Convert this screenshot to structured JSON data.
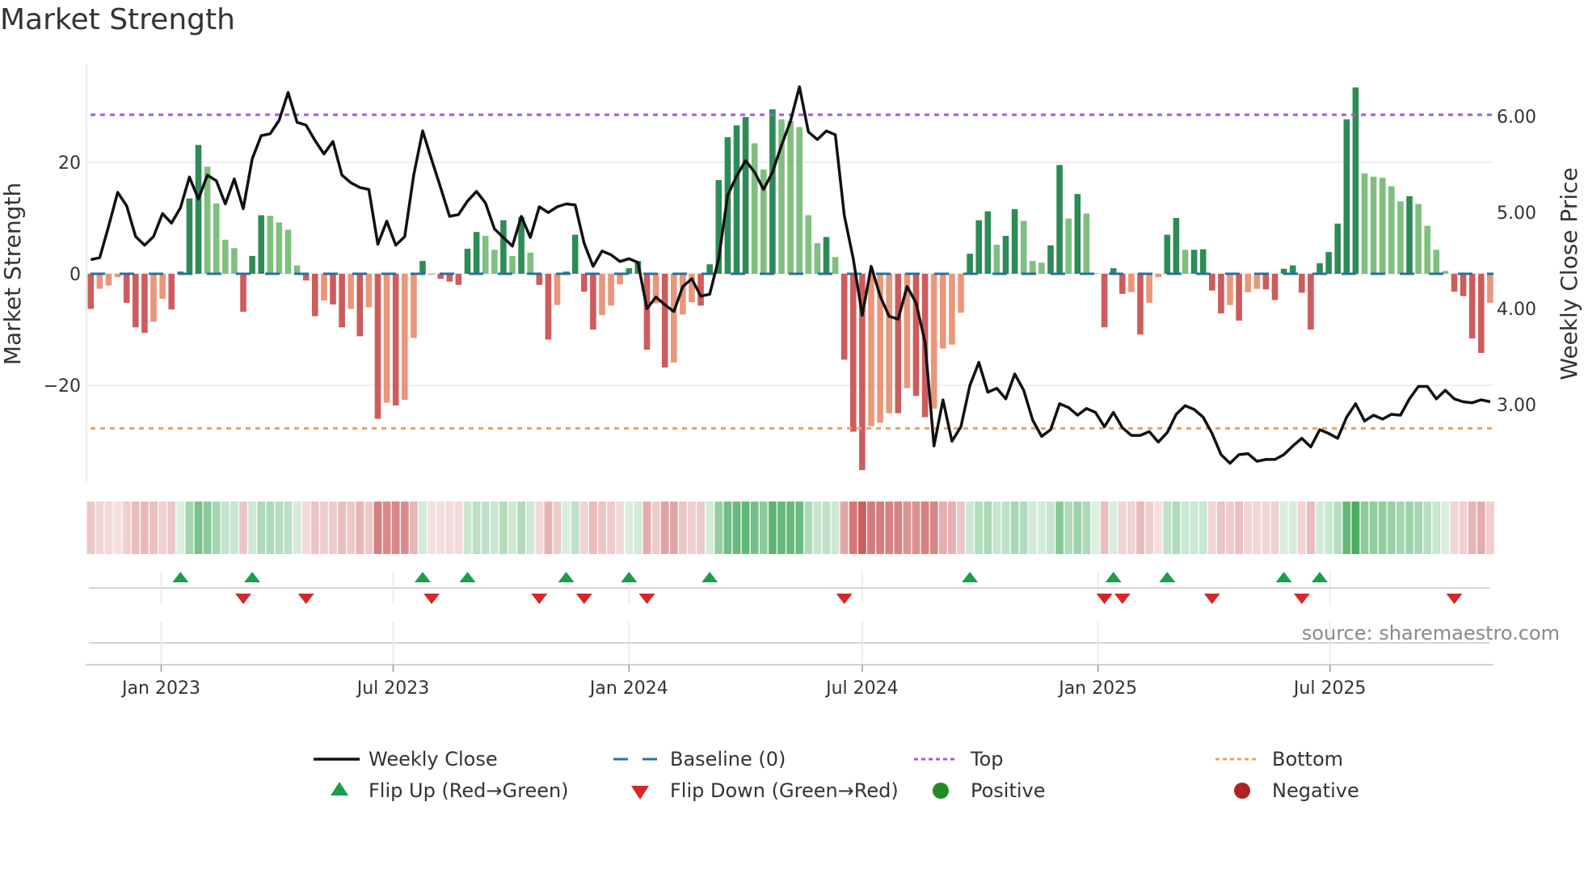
{
  "title": "Market Strength",
  "source": "source: sharemaestro.com",
  "chart_data": {
    "type": "bar",
    "title": "Market Strength",
    "ylabel_left": "Market Strength",
    "ylabel_right": "Weekly Close Price",
    "x_start": "2022-11-07",
    "x_step_days": 7,
    "ylim_left": [
      -37.5,
      37.5
    ],
    "ylim_right": [
      2.185,
      6.54
    ],
    "y_left_ticks": [
      -20,
      0,
      20
    ],
    "y_left_tick_labels": [
      "−20",
      "0",
      "20"
    ],
    "y_right_ticks": [
      3,
      4,
      5,
      6
    ],
    "y_right_tick_labels": [
      "3.00",
      "4.00",
      "5.00",
      "6.00"
    ],
    "x_ticks": [
      "2023-01-01",
      "2023-07-01",
      "2024-01-01",
      "2024-07-01",
      "2025-01-01",
      "2025-07-01"
    ],
    "x_tick_labels": [
      "Jan 2023",
      "Jul 2023",
      "Jan 2024",
      "Jul 2024",
      "Jan 2025",
      "Jul 2025"
    ],
    "top_level": 28.5,
    "bottom_level": -27.7,
    "baseline": 0,
    "grid": true,
    "strength": [
      -6.3,
      -2.7,
      -2.1,
      -0.6,
      -5.2,
      -9.6,
      -10.6,
      -8.6,
      -4.5,
      -6.4,
      0.4,
      13.5,
      23.1,
      19.2,
      12.6,
      6.1,
      4.6,
      -6.8,
      3.2,
      10.5,
      10.4,
      9.2,
      7.9,
      1.5,
      -1.2,
      -7.6,
      -4.8,
      -5.5,
      -9.6,
      -6.3,
      -11.2,
      -6.0,
      -26.0,
      -23.1,
      -23.6,
      -22.6,
      -11.5,
      2.3,
      -0.1,
      -0.9,
      -1.4,
      -2.0,
      4.5,
      7.5,
      6.8,
      4.3,
      9.6,
      3.2,
      10.2,
      3.8,
      -2.0,
      -11.8,
      -5.6,
      0.4,
      7.0,
      -3.2,
      -10.0,
      -7.4,
      -5.7,
      -1.9,
      1.0,
      2.3,
      -13.6,
      -5.3,
      -16.8,
      -15.9,
      -7.3,
      -5.1,
      -5.7,
      1.7,
      16.8,
      24.5,
      26.6,
      28.1,
      23.4,
      18.7,
      29.5,
      27.7,
      27.4,
      26.3,
      10.5,
      5.5,
      6.6,
      3.0,
      -15.4,
      -28.3,
      -35.2,
      -27.3,
      -26.7,
      -25.0,
      -25.0,
      -20.5,
      -21.9,
      -25.7,
      -24.2,
      -13.4,
      -12.7,
      -7.0,
      3.6,
      9.6,
      11.2,
      5.2,
      6.8,
      11.6,
      9.5,
      2.3,
      2.0,
      5.1,
      19.5,
      9.9,
      14.3,
      10.8,
      0.1,
      -9.6,
      1.0,
      -3.6,
      -3.3,
      -10.9,
      -5.2,
      -0.6,
      7.0,
      10.0,
      4.3,
      4.3,
      4.4,
      -3.0,
      -7.1,
      -5.6,
      -8.4,
      -3.3,
      -2.7,
      -2.8,
      -4.7,
      0.9,
      1.5,
      -3.4,
      -10.0,
      1.9,
      3.9,
      9.0,
      27.7,
      33.4,
      18.0,
      17.4,
      17.2,
      15.7,
      13.0,
      13.9,
      12.5,
      8.6,
      4.3,
      0.5,
      -3.2,
      -4.0,
      -11.6,
      -14.2,
      -5.2
    ],
    "close": [
      4.51,
      4.53,
      4.86,
      5.21,
      5.07,
      4.75,
      4.66,
      4.75,
      4.99,
      4.89,
      5.05,
      5.37,
      5.14,
      5.39,
      5.33,
      5.09,
      5.35,
      5.04,
      5.56,
      5.8,
      5.82,
      5.96,
      6.25,
      5.94,
      5.91,
      5.75,
      5.61,
      5.74,
      5.39,
      5.31,
      5.26,
      5.24,
      4.67,
      4.91,
      4.66,
      4.75,
      5.39,
      5.85,
      5.55,
      5.26,
      4.96,
      4.98,
      5.12,
      5.22,
      5.1,
      4.83,
      4.74,
      4.65,
      4.96,
      4.74,
      5.06,
      5.0,
      5.06,
      5.09,
      5.08,
      4.68,
      4.44,
      4.6,
      4.56,
      4.49,
      4.52,
      4.48,
      4.0,
      4.12,
      4.04,
      3.97,
      4.23,
      4.31,
      4.13,
      4.15,
      4.52,
      5.18,
      5.38,
      5.54,
      5.42,
      5.24,
      5.42,
      5.7,
      5.95,
      6.31,
      5.84,
      5.76,
      5.85,
      5.81,
      4.97,
      4.52,
      3.93,
      4.44,
      4.13,
      3.92,
      3.89,
      4.23,
      4.06,
      3.65,
      2.57,
      3.05,
      2.62,
      2.77,
      3.2,
      3.44,
      3.13,
      3.17,
      3.06,
      3.32,
      3.15,
      2.84,
      2.67,
      2.74,
      3.01,
      2.97,
      2.89,
      2.96,
      2.92,
      2.77,
      2.92,
      2.76,
      2.68,
      2.68,
      2.72,
      2.61,
      2.71,
      2.9,
      2.99,
      2.95,
      2.87,
      2.7,
      2.48,
      2.39,
      2.48,
      2.49,
      2.41,
      2.43,
      2.43,
      2.48,
      2.57,
      2.65,
      2.56,
      2.74,
      2.7,
      2.65,
      2.87,
      3.01,
      2.83,
      2.89,
      2.85,
      2.9,
      2.89,
      3.06,
      3.19,
      3.19,
      3.06,
      3.15,
      3.06,
      3.03,
      3.02,
      3.05,
      3.03
    ],
    "flip_up_index": [
      10,
      18,
      37,
      42,
      53,
      60,
      69,
      98,
      114,
      120,
      133,
      137
    ],
    "flip_down_index": [
      17,
      24,
      38,
      50,
      55,
      62,
      84,
      113,
      115,
      125,
      135,
      152
    ],
    "legend_position": "bottom",
    "legend": [
      {
        "label": "Weekly Close",
        "kind": "line"
      },
      {
        "label": "Baseline (0)",
        "kind": "dashed"
      },
      {
        "label": "Top",
        "kind": "dotted-top"
      },
      {
        "label": "Bottom",
        "kind": "dotted-bottom"
      },
      {
        "label": "Flip Up (Red→Green)",
        "kind": "triangle-up"
      },
      {
        "label": "Flip Down (Green→Red)",
        "kind": "triangle-down"
      },
      {
        "label": "Positive",
        "kind": "dot-positive"
      },
      {
        "label": "Negative",
        "kind": "dot-negative"
      }
    ],
    "colors": {
      "pos_strong": "#2e8b57",
      "pos_weak": "#7fbf7f",
      "neg_strong": "#cd5c5c",
      "neg_weak": "#e9967a",
      "close": "#111111",
      "baseline": "#2a6f9e",
      "top": "#9b5de5",
      "bottom": "#f0a060",
      "flip_up": "#1a9e4a",
      "flip_down": "#d62728",
      "positive": "#228b22",
      "negative": "#b22222"
    }
  }
}
